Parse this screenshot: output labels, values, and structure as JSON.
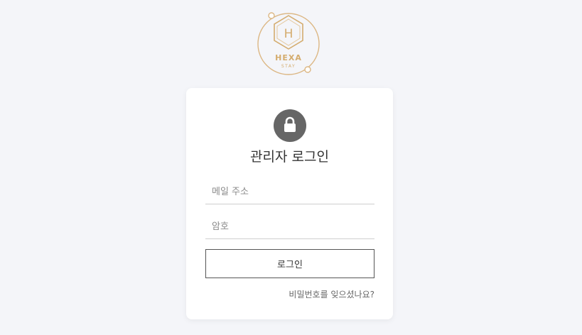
{
  "logo": {
    "brand": "HEXA",
    "sub": "STAY",
    "letter": "H",
    "color": "#d4ac6e"
  },
  "login": {
    "title": "관리자 로그인",
    "lock_icon": "lock-icon",
    "email_placeholder": "메일 주소",
    "password_placeholder": "암호",
    "submit_label": "로그인",
    "forgot_label": "비밀번호를 잊으셨나요?"
  },
  "colors": {
    "background": "#f4f5f9",
    "card": "#ffffff",
    "lock_circle": "#666666",
    "accent_gold": "#d4ac6e"
  }
}
